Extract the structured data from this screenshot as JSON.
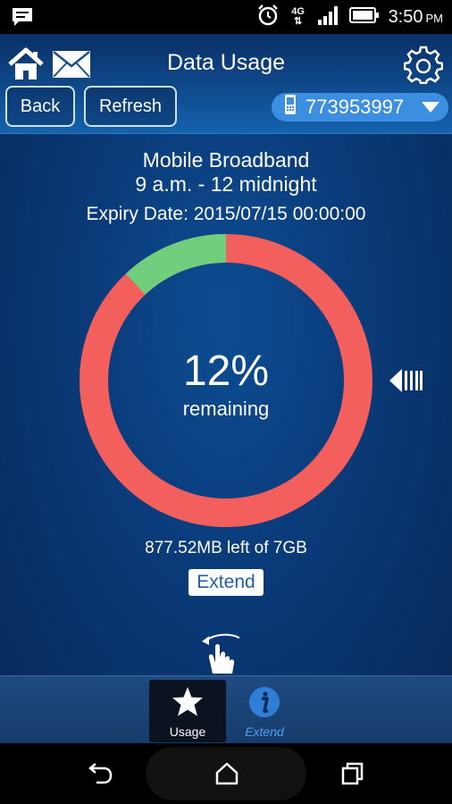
{
  "status_bar": {
    "notification_icon": "message-notification-icon",
    "alarm_icon": "alarm-clock-icon",
    "network_type": "4G",
    "signal_icon": "signal-bars-icon",
    "battery_icon": "battery-icon",
    "time": "3:50",
    "ampm": "PM"
  },
  "header": {
    "title": "Data Usage",
    "home_icon": "home-icon",
    "mail_icon": "mail-icon",
    "settings_icon": "gear-icon",
    "back_label": "Back",
    "refresh_label": "Refresh",
    "phone_number": "773953997",
    "phone_icon": "mobile-phone-icon"
  },
  "plan": {
    "name": "Mobile Broadband",
    "hours": "9 a.m. - 12 midnight",
    "expiry": "Expiry Date: 2015/07/15 00:00:00"
  },
  "usage": {
    "percent_text": "12%",
    "percent_label": "remaining",
    "remaining_fraction": 0.12,
    "used_color": "#f25f5c",
    "remaining_color": "#6fcf7f",
    "left_text": "877.52MB left of 7GB",
    "extend_label": "Extend"
  },
  "tabs": [
    {
      "label": "Usage",
      "icon": "star-icon",
      "active": true
    },
    {
      "label": "Extend",
      "icon": "info-icon",
      "active": false
    }
  ],
  "nav": {
    "back_icon": "nav-back-icon",
    "home_icon": "nav-home-icon",
    "recents_icon": "nav-recents-icon"
  }
}
